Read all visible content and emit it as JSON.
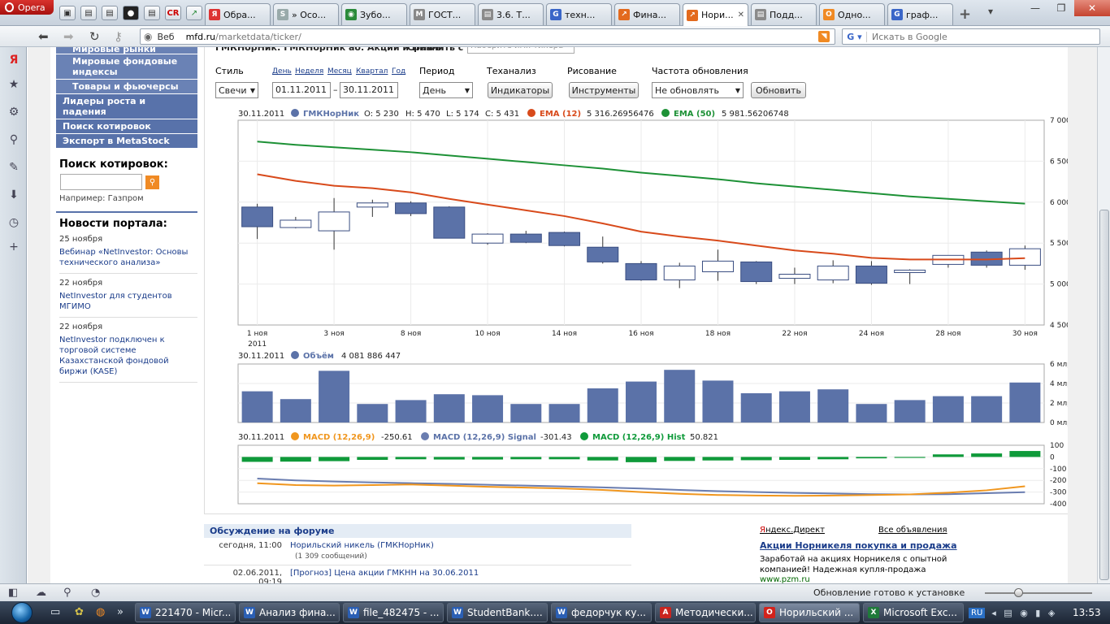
{
  "browser": {
    "app_name": "Opera",
    "tabs": [
      {
        "label": "Обра...",
        "fav": "Я",
        "fav_color": "#d33"
      },
      {
        "label": "» Осо...",
        "fav": "S",
        "fav_color": "#9aa"
      },
      {
        "label": "Зубо...",
        "fav": "◉",
        "fav_color": "#2a8a3a"
      },
      {
        "label": "ГОСТ...",
        "fav": "M",
        "fav_color": "#888"
      },
      {
        "label": "3.6. Т...",
        "fav": "▤",
        "fav_color": "#8a8a8a"
      },
      {
        "label": "техн...",
        "fav": "G",
        "fav_color": "#3a66c8"
      },
      {
        "label": "Фина...",
        "fav": "↗",
        "fav_color": "#e36a1e"
      },
      {
        "label": "Нори...",
        "fav": "↗",
        "fav_color": "#e36a1e",
        "active": true
      },
      {
        "label": "Подд...",
        "fav": "▤",
        "fav_color": "#8a8a8a"
      },
      {
        "label": "Одно...",
        "fav": "О",
        "fav_color": "#f08a24"
      },
      {
        "label": "граф...",
        "fav": "G",
        "fav_color": "#3a66c8"
      }
    ],
    "address": {
      "zone": "Веб",
      "host": "mfd.ru",
      "path": "/marketdata/ticker/"
    },
    "search_placeholder": "Искать в Google",
    "status_text": "Обновление готово к установке"
  },
  "leftmenu": {
    "items": [
      {
        "label": "Мировые рынки",
        "sub": true,
        "clip": true
      },
      {
        "label": "Мировые фондовые индексы",
        "sub": true
      },
      {
        "label": "Товары и фьючерсы",
        "sub": true
      },
      {
        "label": "Лидеры роста и падения",
        "sub": false
      },
      {
        "label": "Поиск котировок",
        "sub": false
      },
      {
        "label": "Экспорт в MetaStock",
        "sub": false
      }
    ],
    "quote_search_title": "Поиск котировок:",
    "quote_search_hint": "Например: Газпром",
    "news_title": "Новости портала:",
    "news": [
      {
        "date": "25 ноября",
        "text": "Вебинар «NetInvestor: Основы технического анализа»"
      },
      {
        "date": "22 ноября",
        "text": "NetInvestor для студентов МГИМО"
      },
      {
        "date": "22 ноября",
        "text": "NetInvestor подключен к торговой системе Казахстанской фондовой биржи (KASE)"
      }
    ]
  },
  "toolbar": {
    "ticker_line": "ГМКНорНик: ГМКНорНик ао. Акции и ПИФы",
    "compare_label": "Сравнить с",
    "compare_placeholder": "Наберите имя тикера",
    "style_label": "Стиль",
    "style_value": "Свечи",
    "quick_periods": [
      "День",
      "Неделя",
      "Месяц",
      "Квартал",
      "Год"
    ],
    "date_from": "01.11.2011",
    "date_sep": "–",
    "date_to": "30.11.2011",
    "period_label": "Период",
    "period_value": "День",
    "ta_label": "Теханализ",
    "ta_button": "Индикаторы",
    "draw_label": "Рисование",
    "draw_button": "Инструменты",
    "freq_label": "Частота обновления",
    "freq_value": "Не обновлять",
    "refresh_button": "Обновить"
  },
  "chart_data": [
    {
      "type": "candlestick",
      "header": {
        "date": "30.11.2011",
        "ticker": "ГМКНорНик",
        "o": "O: 5 230",
        "h": "H: 5 470",
        "l": "L: 5 174",
        "c": "C: 5 431",
        "ema12_label": "EMA (12)",
        "ema12_value": "5 316.26956476",
        "ema50_label": "EMA (50)",
        "ema50_value": "5 981.56206748"
      },
      "ylim": [
        4500,
        7000
      ],
      "yticks": [
        "4 500",
        "5 000",
        "5 500",
        "6 000",
        "6 500",
        "7 000"
      ],
      "xtick_labels": [
        "1 ноя",
        "3 ноя",
        "8 ноя",
        "10 ноя",
        "14 ноя",
        "16 ноя",
        "18 ноя",
        "22 ноя",
        "24 ноя",
        "28 ноя",
        "30 ноя"
      ],
      "xtick_year": "2011",
      "candles": [
        {
          "o": 5940,
          "h": 5980,
          "l": 5550,
          "c": 5700
        },
        {
          "o": 5690,
          "h": 5820,
          "l": 5680,
          "c": 5780
        },
        {
          "o": 5650,
          "h": 6050,
          "l": 5420,
          "c": 5880
        },
        {
          "o": 5940,
          "h": 6030,
          "l": 5820,
          "c": 5990
        },
        {
          "o": 5990,
          "h": 6010,
          "l": 5830,
          "c": 5860
        },
        {
          "o": 5940,
          "h": 5950,
          "l": 5560,
          "c": 5560
        },
        {
          "o": 5500,
          "h": 5620,
          "l": 5480,
          "c": 5610
        },
        {
          "o": 5610,
          "h": 5650,
          "l": 5500,
          "c": 5510
        },
        {
          "o": 5630,
          "h": 5640,
          "l": 5460,
          "c": 5470
        },
        {
          "o": 5450,
          "h": 5580,
          "l": 5250,
          "c": 5270
        },
        {
          "o": 5250,
          "h": 5280,
          "l": 5040,
          "c": 5050
        },
        {
          "o": 5050,
          "h": 5260,
          "l": 4950,
          "c": 5220
        },
        {
          "o": 5150,
          "h": 5420,
          "l": 5040,
          "c": 5280
        },
        {
          "o": 5270,
          "h": 5280,
          "l": 5000,
          "c": 5030
        },
        {
          "o": 5070,
          "h": 5200,
          "l": 5000,
          "c": 5120
        },
        {
          "o": 5050,
          "h": 5290,
          "l": 5010,
          "c": 5220
        },
        {
          "o": 5220,
          "h": 5280,
          "l": 4990,
          "c": 5010
        },
        {
          "o": 5140,
          "h": 5180,
          "l": 5000,
          "c": 5170
        },
        {
          "o": 5240,
          "h": 5350,
          "l": 5200,
          "c": 5350
        },
        {
          "o": 5390,
          "h": 5410,
          "l": 5200,
          "c": 5230
        },
        {
          "o": 5230,
          "h": 5470,
          "l": 5174,
          "c": 5431
        }
      ],
      "ema12": [
        6340,
        6260,
        6200,
        6170,
        6120,
        6040,
        5970,
        5900,
        5830,
        5740,
        5640,
        5580,
        5530,
        5470,
        5410,
        5370,
        5320,
        5300,
        5300,
        5300,
        5316
      ],
      "ema50": [
        6740,
        6700,
        6670,
        6640,
        6610,
        6570,
        6530,
        6490,
        6450,
        6410,
        6360,
        6320,
        6280,
        6230,
        6190,
        6150,
        6110,
        6070,
        6040,
        6010,
        5982
      ]
    },
    {
      "type": "bar",
      "header": {
        "date": "30.11.2011",
        "label": "Объём",
        "value": "4 081 886 447"
      },
      "ylim": [
        0,
        6
      ],
      "yticks": [
        "0 млрд",
        "2 млрд",
        "4 млрд",
        "6 млрд"
      ],
      "values": [
        3.2,
        2.4,
        5.3,
        1.9,
        2.3,
        2.9,
        2.8,
        1.9,
        1.9,
        3.5,
        4.2,
        5.4,
        4.3,
        3.0,
        3.2,
        3.4,
        1.9,
        2.3,
        2.7,
        2.7,
        4.1
      ]
    },
    {
      "type": "line",
      "header": {
        "date": "30.11.2011",
        "macd_label": "MACD (12,26,9)",
        "macd_value": "-250.61",
        "signal_label": "MACD (12,26,9) Signal",
        "signal_value": "-301.43",
        "hist_label": "MACD (12,26,9) Hist",
        "hist_value": "50.821"
      },
      "ylim": [
        -400,
        100
      ],
      "yticks": [
        "100",
        "0",
        "-100",
        "-200",
        "-300",
        "-400"
      ],
      "macd": [
        -225,
        -240,
        -245,
        -240,
        -235,
        -245,
        -255,
        -262,
        -270,
        -282,
        -300,
        -315,
        -325,
        -330,
        -332,
        -330,
        -325,
        -320,
        -305,
        -285,
        -251
      ],
      "signal": [
        -185,
        -200,
        -210,
        -218,
        -224,
        -230,
        -238,
        -245,
        -252,
        -260,
        -270,
        -282,
        -292,
        -300,
        -307,
        -312,
        -318,
        -320,
        -318,
        -310,
        -301
      ],
      "hist": [
        -42,
        -40,
        -36,
        -25,
        -20,
        -22,
        -22,
        -20,
        -20,
        -30,
        -45,
        -34,
        -30,
        -28,
        -25,
        -20,
        -12,
        -8,
        22,
        30,
        51
      ]
    }
  ],
  "forum": {
    "title": "Обсуждение на форуме",
    "rows": [
      {
        "when": "сегодня, 11:00",
        "title": "Норильский никель (ГМКНорНик)",
        "sub": "(1 309 сообщений)"
      },
      {
        "when": "02.06.2011, 09:19",
        "title": "[Прогноз] Цена акции ГМКНН на 30.06.2011",
        "sub": ""
      }
    ]
  },
  "ads": {
    "yd_red": "Я",
    "yd_rest": "ндекс.Директ",
    "all_label": "Все объявления",
    "ad_title": "Акции Норникеля покупка и продажа",
    "ad_text": "Заработай на акциях Норникеля с опытной компанией! Надежная купля-продажа",
    "ad_url": "www.pzm.ru"
  },
  "taskbar": {
    "tasks": [
      {
        "label": "221470 - Micr...",
        "icon": "W",
        "color": "#2b5fb4"
      },
      {
        "label": "Анализ фина...",
        "icon": "W",
        "color": "#2b5fb4"
      },
      {
        "label": "file_482475 - ...",
        "icon": "W",
        "color": "#2b5fb4"
      },
      {
        "label": "StudentBank....",
        "icon": "W",
        "color": "#2b5fb4"
      },
      {
        "label": "федорчук ку...",
        "icon": "W",
        "color": "#2b5fb4"
      },
      {
        "label": "Методически...",
        "icon": "A",
        "color": "#c9251f"
      },
      {
        "label": "Норильский ...",
        "icon": "O",
        "color": "#d3231c",
        "active": true
      },
      {
        "label": "Microsoft Exc...",
        "icon": "X",
        "color": "#1f7a3a"
      }
    ],
    "lang": "RU",
    "clock": "13:53"
  },
  "colors": {
    "candle": "#5b72a8",
    "ema12": "#d84a1b",
    "ema50": "#1d9136",
    "volume": "#5b72a8",
    "macd": "#f0961e",
    "signal": "#6a7db0",
    "hist": "#0f9a3a"
  }
}
